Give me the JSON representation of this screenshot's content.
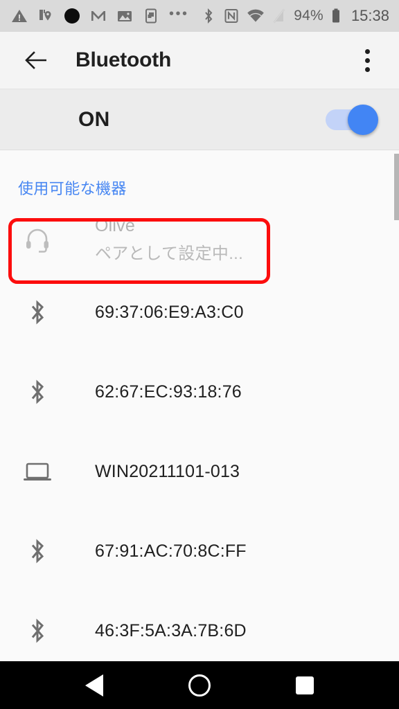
{
  "statusbar": {
    "icons_left": [
      {
        "name": "warning-triangle-icon"
      },
      {
        "name": "location-pin-icon"
      },
      {
        "name": "filled-circle-icon"
      },
      {
        "name": "gmail-icon"
      },
      {
        "name": "photo-image-icon"
      },
      {
        "name": "screenshot-icon"
      },
      {
        "name": "more-dots-icon",
        "glyph": "•••"
      }
    ],
    "icons_right": [
      {
        "name": "bluetooth-icon"
      },
      {
        "name": "nfc-icon"
      },
      {
        "name": "wifi-icon"
      },
      {
        "name": "no-signal-icon"
      }
    ],
    "battery_percent": "94%",
    "time": "15:38"
  },
  "appbar": {
    "back_label": "back",
    "title": "Bluetooth",
    "overflow_label": "more options"
  },
  "master_switch": {
    "label": "ON",
    "enabled": true
  },
  "list": {
    "section_header": "使用可能な機器",
    "devices": [
      {
        "name": "Olive",
        "status": "ペアとして設定中...",
        "icon": "headset-icon",
        "highlighted": true,
        "dimmed": true
      },
      {
        "name": "69:37:06:E9:A3:C0",
        "status": "",
        "icon": "bluetooth-icon",
        "highlighted": false,
        "dimmed": false
      },
      {
        "name": "62:67:EC:93:18:76",
        "status": "",
        "icon": "bluetooth-icon",
        "highlighted": false,
        "dimmed": false
      },
      {
        "name": "WIN20211101-013",
        "status": "",
        "icon": "laptop-icon",
        "highlighted": false,
        "dimmed": false
      },
      {
        "name": "67:91:AC:70:8C:FF",
        "status": "",
        "icon": "bluetooth-icon",
        "highlighted": false,
        "dimmed": false
      },
      {
        "name": "46:3F:5A:3A:7B:6D",
        "status": "",
        "icon": "bluetooth-icon",
        "highlighted": false,
        "dimmed": false
      }
    ]
  },
  "navbar": {
    "back_label": "back",
    "home_label": "home",
    "recents_label": "recent apps"
  },
  "colors": {
    "accent_blue": "#4285f4",
    "section_header_blue": "#4887f2",
    "highlight_red": "#fc0d0d",
    "statusbar_bg": "#dadada",
    "appbar_bg": "#f4f4f4",
    "switchrow_bg": "#ececec",
    "list_bg": "#fafafa"
  }
}
